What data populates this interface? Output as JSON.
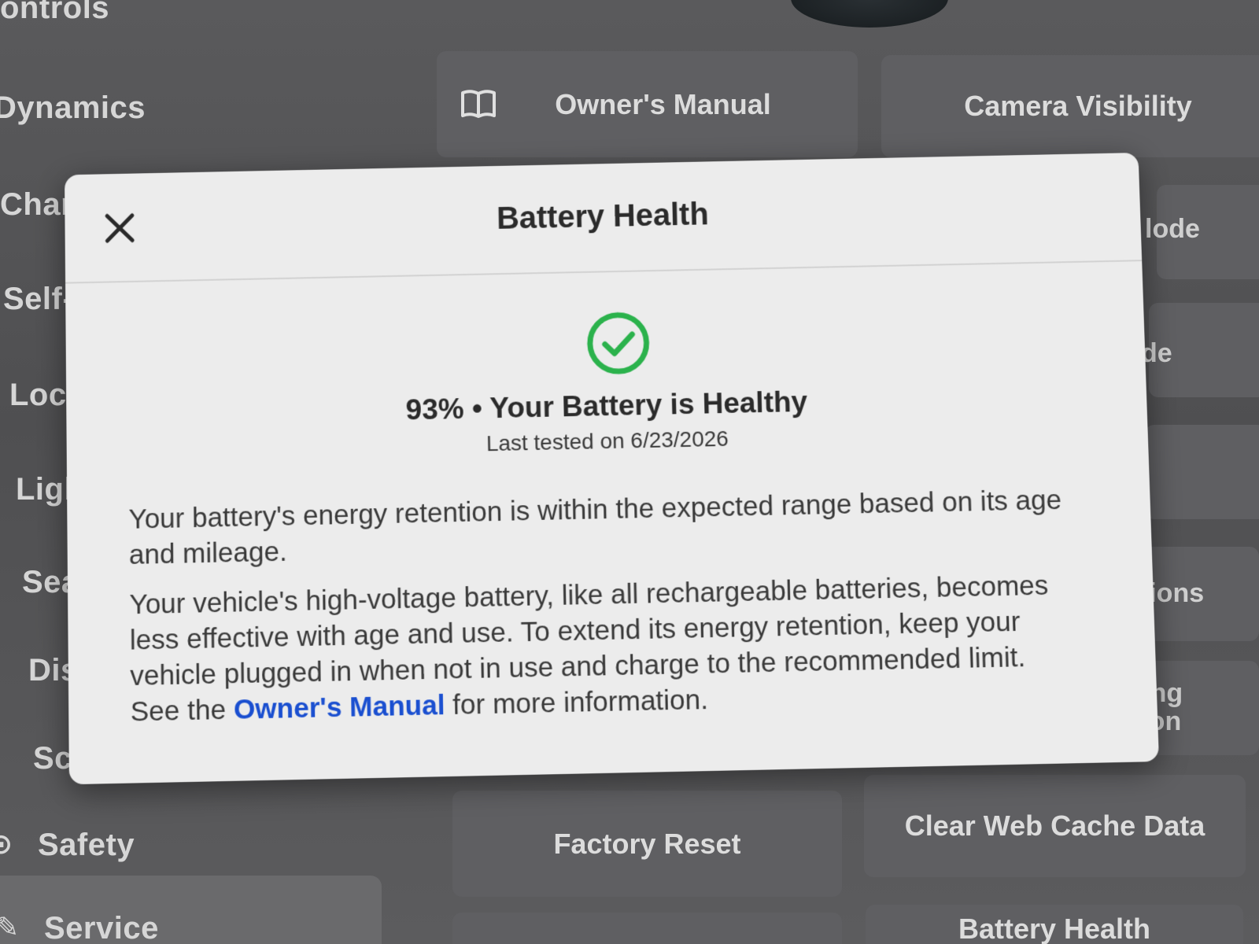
{
  "background": {
    "sidebar": {
      "items": [
        {
          "label": "ontrols",
          "icon": ""
        },
        {
          "label": "Dynamics",
          "icon": ""
        },
        {
          "label": "Char",
          "icon": ""
        },
        {
          "label": "Self-",
          "icon": ""
        },
        {
          "label": "Lock",
          "icon": ""
        },
        {
          "label": "Light",
          "icon": ""
        },
        {
          "label": "Seat",
          "icon": ""
        },
        {
          "label": "Disp",
          "icon": ""
        },
        {
          "label": "Sche",
          "icon": ""
        },
        {
          "label": "Safety",
          "icon": ""
        },
        {
          "label": "Service",
          "icon": "wrench-icon",
          "selected": true
        }
      ]
    },
    "tiles": {
      "owners_manual": "Owner's Manual",
      "camera_visibility": "Camera Visibility",
      "factory_reset": "Factory Reset",
      "clear_web_cache": "Clear Web Cache Data",
      "battery_health": "Battery Health"
    },
    "right_edge_fragments": [
      "lode",
      "de",
      "ations",
      "ering",
      "ation"
    ]
  },
  "modal": {
    "title": "Battery Health",
    "close_icon": "close-icon",
    "status_icon": "check-circle-icon",
    "status_color": "#2bb24c",
    "health_percent": "93%",
    "separator": "•",
    "status_text": "Your Battery is Healthy",
    "last_tested": "Last tested on 6/23/2026",
    "paragraph1": "Your battery's energy retention is within the expected range based on its age and mileage.",
    "paragraph2_before_link": "Your vehicle's high-voltage battery, like all rechargeable batteries, becomes less effective with age and use. To extend its energy retention, keep your vehicle plugged in when not in use and charge to the recommended limit. See the ",
    "paragraph2_link": "Owner's Manual",
    "paragraph2_after_link": " for more information.",
    "link_color": "#1a4fd0"
  }
}
